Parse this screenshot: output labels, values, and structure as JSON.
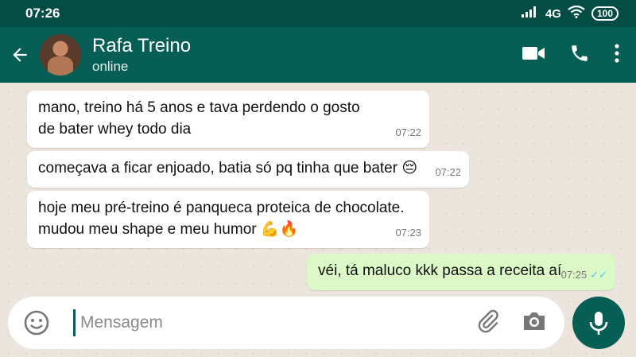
{
  "status_bar": {
    "time": "07:26",
    "network": "4G",
    "battery": "100"
  },
  "header": {
    "contact_name": "Rafa Treino",
    "status": "online"
  },
  "messages": [
    {
      "lines": [
        "mano, treino há 5 anos e tava perdendo o gosto",
        "de bater whey todo dia"
      ],
      "time": "07:22"
    },
    {
      "lines": [
        "começava a ficar enjoado, batia só pq tinha que bater 😔"
      ],
      "time": "07:22"
    },
    {
      "lines": [
        "hoje meu pré-treino é panqueca proteica de chocolate.",
        "mudou meu shape e meu humor 💪🔥"
      ],
      "time": "07:23"
    },
    {
      "lines": [
        "véi, tá maluco kkk passa a receita aí"
      ],
      "time": "07:25",
      "ticks": "✓✓"
    }
  ],
  "input": {
    "placeholder": "Mensagem"
  },
  "icons": {
    "back": "arrow-left-icon",
    "video": "video-camera-icon",
    "call": "phone-icon",
    "menu": "more-vertical-icon",
    "emoji": "emoji-icon",
    "attach": "paperclip-icon",
    "camera": "camera-icon",
    "mic": "microphone-icon"
  },
  "colors": {
    "header": "#075e54",
    "outgoing_bubble": "#dcf8c6",
    "chat_bg": "#ece5dd",
    "read_ticks": "#4fc3f7"
  }
}
